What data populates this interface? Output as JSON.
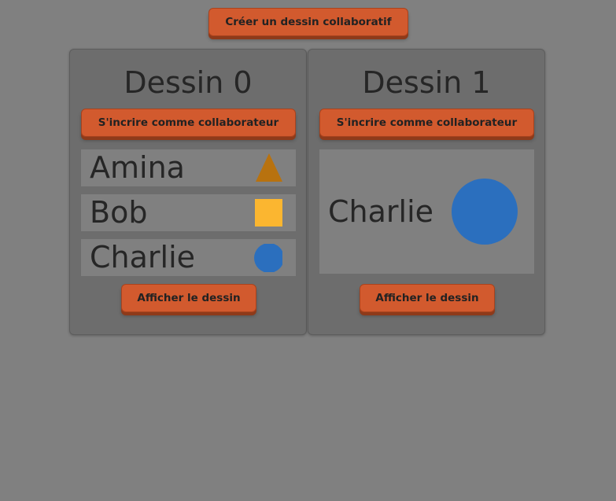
{
  "header": {
    "create_label": "Créer un dessin collaboratif"
  },
  "drawings": [
    {
      "title": "Dessin 0",
      "subscribe_label": "S'incrire comme collaborateur",
      "show_label": "Afficher le dessin",
      "collaborators": [
        {
          "name": "Amina",
          "shape": "triangle",
          "color": "#b8720f"
        },
        {
          "name": "Bob",
          "shape": "square",
          "color": "#fbb630"
        },
        {
          "name": "Charlie",
          "shape": "circle",
          "color": "#2b6fbe"
        }
      ]
    },
    {
      "title": "Dessin 1",
      "subscribe_label": "S'incrire comme collaborateur",
      "show_label": "Afficher le dessin",
      "collaborators": [
        {
          "name": "Charlie",
          "shape": "circle",
          "color": "#2b6fbe"
        }
      ]
    }
  ],
  "colors": {
    "background": "#808080",
    "card": "#6d6d6d",
    "button": "#d25a2e",
    "text": "#262626"
  }
}
